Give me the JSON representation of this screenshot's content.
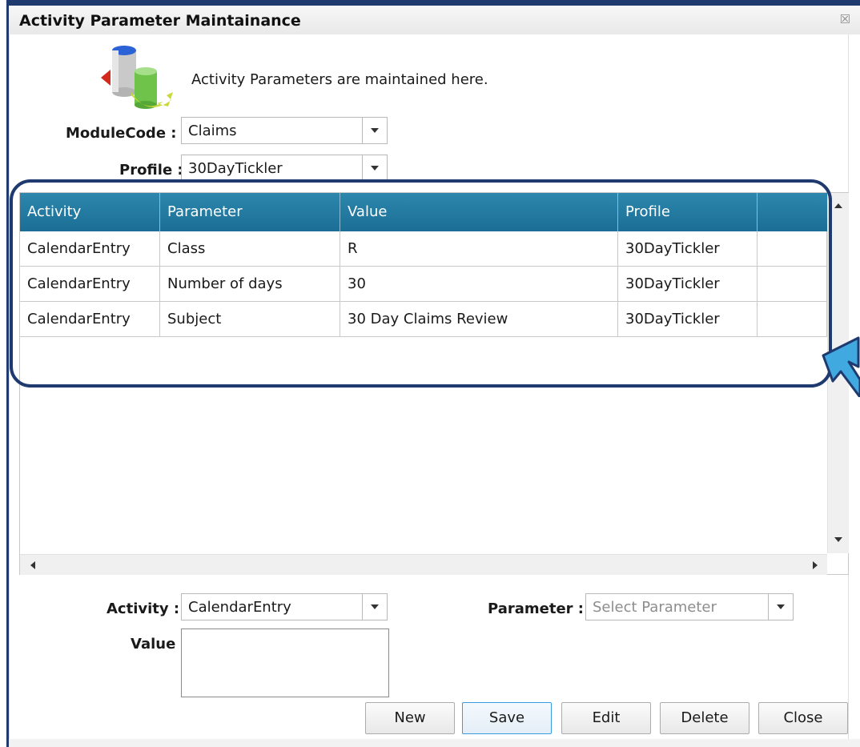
{
  "window": {
    "title": "Activity Parameter Maintainance",
    "close_glyph": "☒"
  },
  "intro": {
    "text": "Activity Parameters are maintained here."
  },
  "filters": {
    "module_label": "ModuleCode :",
    "module_value": "Claims",
    "profile_label": "Profile :",
    "profile_value": "30DayTickler"
  },
  "grid": {
    "columns": [
      "Activity",
      "Parameter",
      "Value",
      "Profile",
      ""
    ],
    "rows": [
      [
        "CalendarEntry",
        "Class",
        "R",
        "30DayTickler",
        ""
      ],
      [
        "CalendarEntry",
        "Number of days",
        "30",
        "30DayTickler",
        ""
      ],
      [
        "CalendarEntry",
        "Subject",
        "30 Day Claims Review",
        "30DayTickler",
        ""
      ]
    ]
  },
  "form": {
    "activity_label": "Activity :",
    "activity_value": "CalendarEntry",
    "parameter_label": "Parameter :",
    "parameter_placeholder": "Select Parameter",
    "value_label": "Value :",
    "value_text": ""
  },
  "buttons": {
    "new": "New",
    "save": "Save",
    "edit": "Edit",
    "delete": "Delete",
    "close": "Close"
  },
  "colors": {
    "header": "#1b6e95",
    "highlight": "#1f3a6e",
    "pointer": "#3fa9e0"
  }
}
